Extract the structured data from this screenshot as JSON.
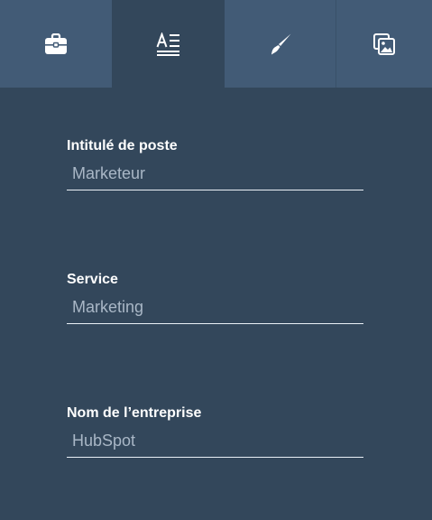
{
  "tabs": [
    {
      "icon": "briefcase-icon",
      "active": false
    },
    {
      "icon": "text-format-icon",
      "active": true
    },
    {
      "icon": "paintbrush-icon",
      "active": false
    },
    {
      "icon": "image-gallery-icon",
      "active": false
    }
  ],
  "fields": {
    "job_title": {
      "label": "Intitulé de poste",
      "value": "",
      "placeholder": "Marketeur"
    },
    "department": {
      "label": "Service",
      "value": "",
      "placeholder": "Marketing"
    },
    "company": {
      "label": "Nom de l’entreprise",
      "value": "",
      "placeholder": "HubSpot"
    }
  },
  "colors": {
    "panel_bg": "#33475b",
    "tab_bg": "#425b76",
    "text": "#ffffff",
    "placeholder": "#a9b7c6",
    "underline": "#eaf0f6"
  }
}
